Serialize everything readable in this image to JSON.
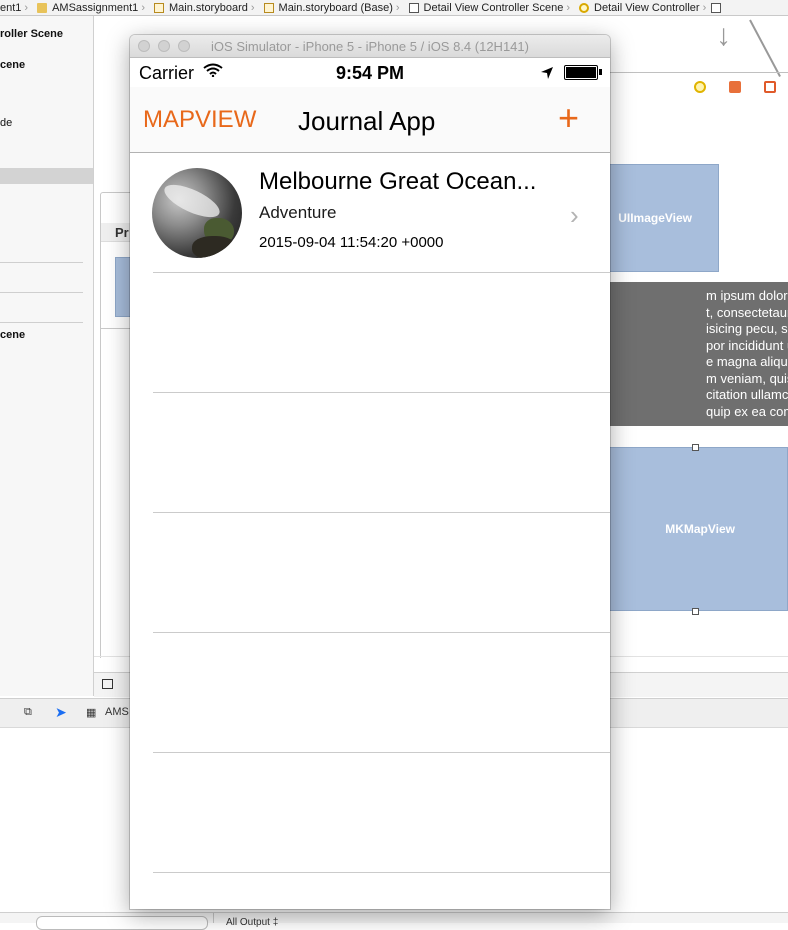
{
  "xcode": {
    "breadcrumbs": [
      "ent1",
      "AMSassignment1",
      "Main.storyboard",
      "Main.storyboard (Base)",
      "Detail View Controller Scene",
      "Detail View Controller"
    ],
    "outline": {
      "scene_1": "roller Scene",
      "scene_2": "cene",
      "item_1": "de",
      "scene_3": "cene"
    },
    "canvas": {
      "uiimageview_label": "UIImageView",
      "textview_text": "m ipsum dolor sit er elit\nt, consectetaur cillium\nisicing pecu, sed do eiusmo\npor incididunt ut labore et\ne magna aliqua. Ut enim ad\nm veniam, quis nostrud\ncitation ullamco laboris nisi\nquip ex ea commodo",
      "mkmapview_label": "MKMapView",
      "partial_scene_label": "Pr",
      "partial_image_label": "U"
    },
    "debug_bar": {
      "target_label": "AMS"
    },
    "output": {
      "label": "All Output ‡"
    }
  },
  "simulator": {
    "window_title": "iOS Simulator - iPhone 5 - iPhone 5 / iOS 8.4 (12H141)",
    "status_bar": {
      "carrier": "Carrier",
      "time": "9:54 PM"
    },
    "nav": {
      "left_button": "MAPVIEW",
      "title": "Journal App",
      "add_button": "+"
    },
    "entries": [
      {
        "title": "Melbourne Great Ocean...",
        "category": "Adventure",
        "date": "2015-09-04 11:54:20 +0000"
      }
    ],
    "accent_color": "#e8681a"
  }
}
